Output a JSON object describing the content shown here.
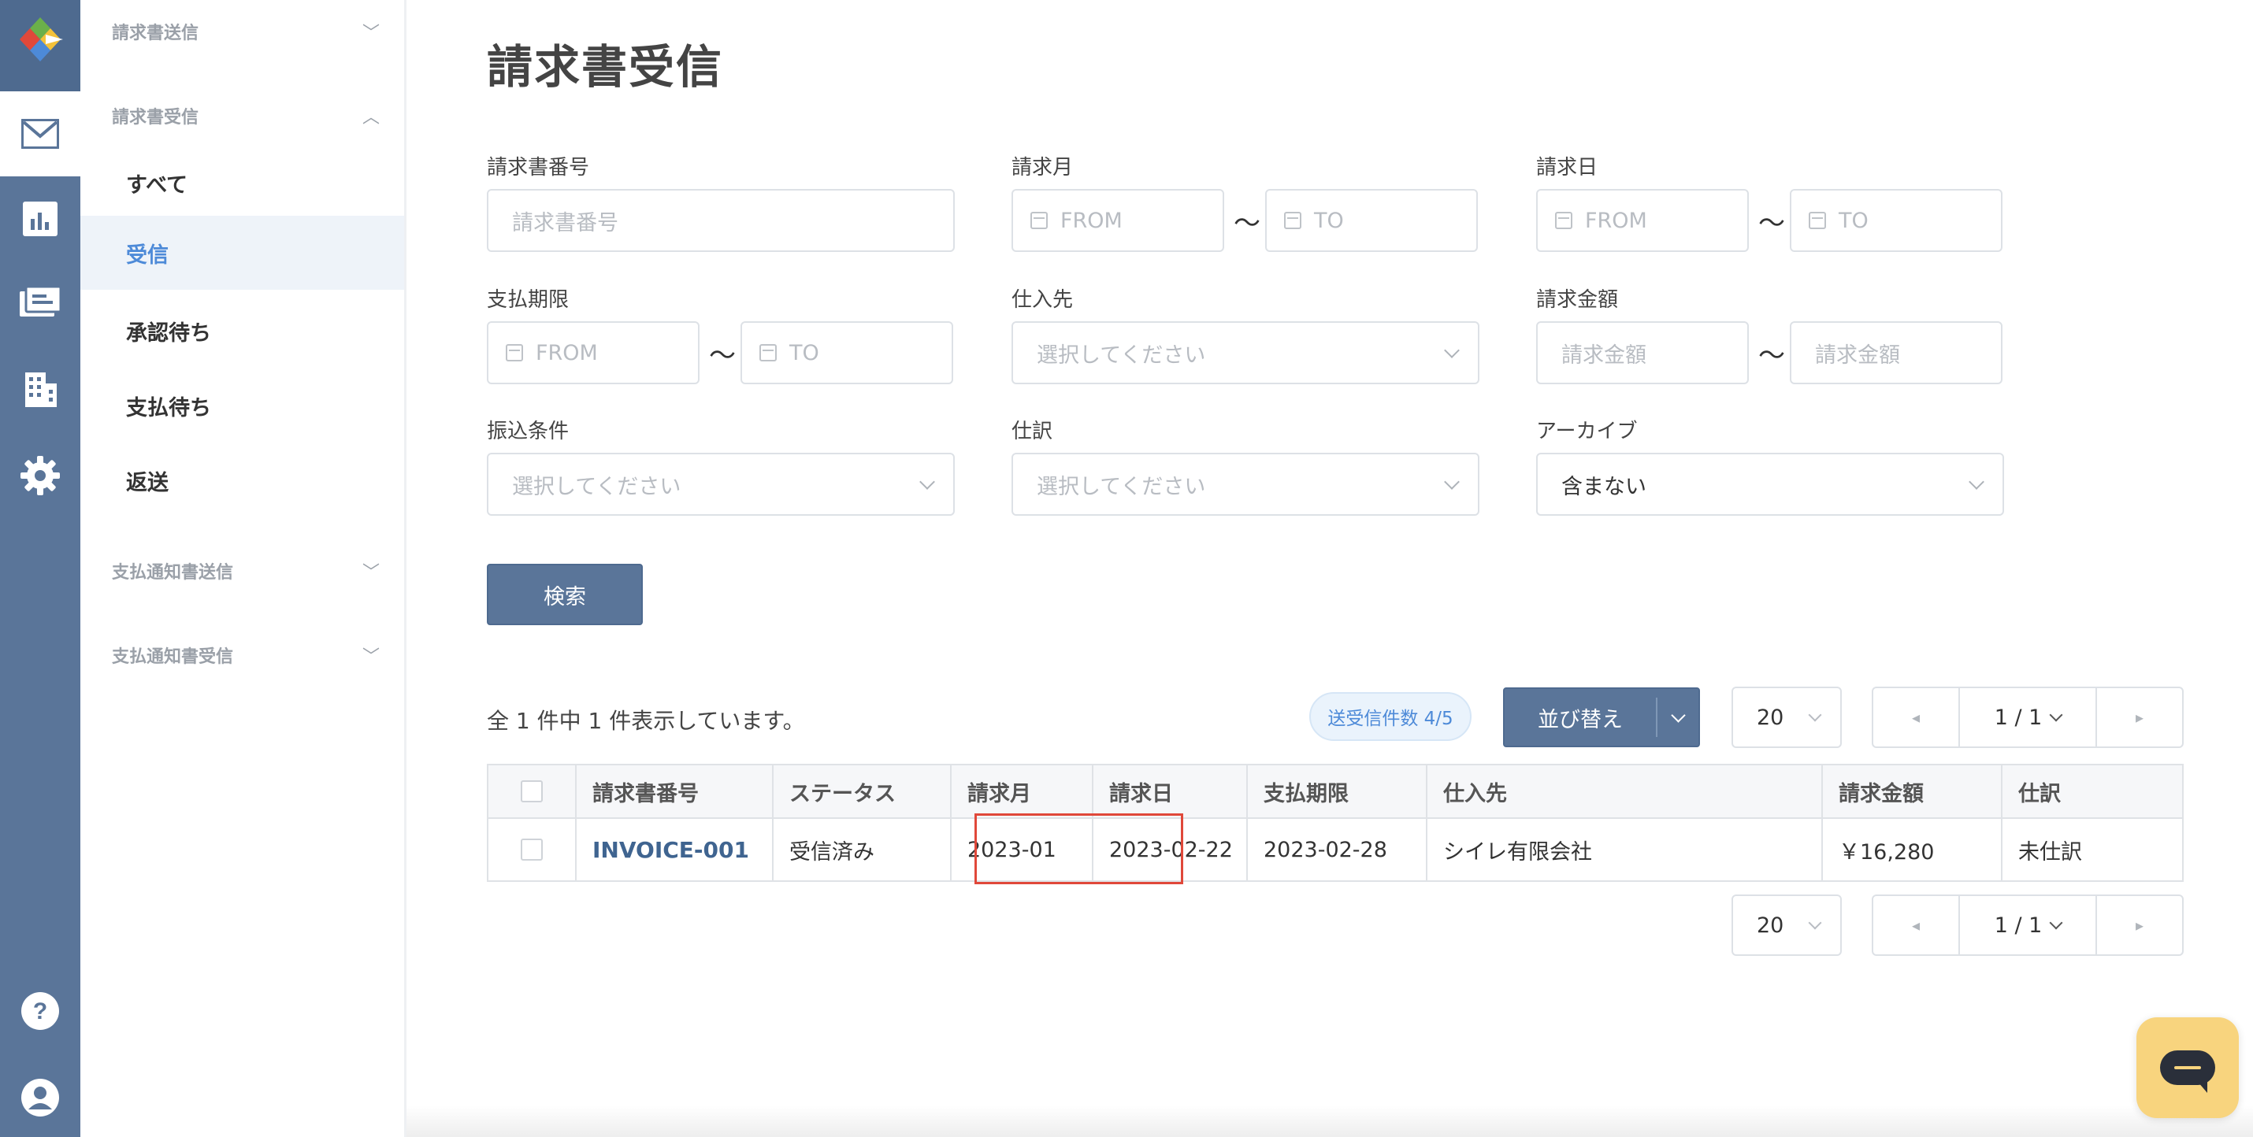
{
  "page": {
    "title": "請求書受信"
  },
  "sidebar": {
    "groups": [
      {
        "label": "請求書送信",
        "chevron": "﹀"
      },
      {
        "label": "請求書受信",
        "chevron": "︿"
      },
      {
        "label": "支払通知書送信",
        "chevron": "﹀"
      },
      {
        "label": "支払通知書受信",
        "chevron": "﹀"
      }
    ],
    "links": [
      {
        "label": "すべて"
      },
      {
        "label": "受信"
      },
      {
        "label": "承認待ち"
      },
      {
        "label": "支払待ち"
      },
      {
        "label": "返送"
      }
    ]
  },
  "rail": {
    "icons": [
      "logo-icon",
      "mail-icon",
      "chart-icon",
      "billing-icon",
      "building-icon",
      "gear-icon",
      "help-icon",
      "account-icon"
    ],
    "colors": {
      "rail": "#5a7599",
      "active": "#ffffff",
      "accent": "#4d8ad8"
    }
  },
  "filters": {
    "invoice_number": {
      "label": "請求書番号",
      "placeholder": "請求書番号"
    },
    "billing_month": {
      "label": "請求月",
      "from": "FROM",
      "to": "TO"
    },
    "billing_date": {
      "label": "請求日",
      "from": "FROM",
      "to": "TO"
    },
    "payment_due": {
      "label": "支払期限",
      "from": "FROM",
      "to": "TO"
    },
    "supplier": {
      "label": "仕入先",
      "placeholder": "選択してください"
    },
    "amount": {
      "label": "請求金額",
      "from": "請求金額",
      "to": "請求金額"
    },
    "transfer_terms": {
      "label": "振込条件",
      "placeholder": "選択してください"
    },
    "journal": {
      "label": "仕訳",
      "placeholder": "選択してください"
    },
    "archive": {
      "label": "アーカイブ",
      "value": "含まない"
    },
    "tilde": "〜",
    "search_button": "検索"
  },
  "results": {
    "summary": "全 1 件中 1 件表示しています。",
    "badge": "送受信件数 4/5",
    "sort_label": "並び替え",
    "per_page": "20",
    "page": "1 / 1",
    "prev_glyph": "◂",
    "next_glyph": "▸"
  },
  "table": {
    "headers": [
      "請求書番号",
      "ステータス",
      "請求月",
      "請求日",
      "支払期限",
      "仕入先",
      "請求金額",
      "仕訳"
    ],
    "rows": [
      [
        "INVOICE-001",
        "受信済み",
        "2023-01",
        "2023-02-22",
        "2023-02-28",
        "シイレ有限会社",
        "￥16,280",
        "未仕訳"
      ]
    ]
  }
}
